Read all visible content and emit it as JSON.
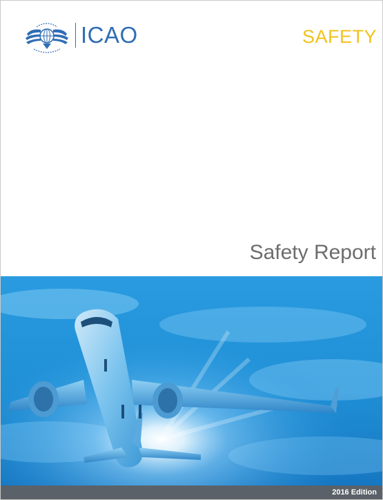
{
  "header": {
    "logo_icon": "un-wreath-emblem-icon",
    "org_name": "ICAO",
    "section_label": "SAFETY"
  },
  "title": "Safety Report",
  "photo": {
    "subject": "airplane-photo"
  },
  "footer": {
    "edition": "2016 Edition"
  },
  "colors": {
    "brand_blue": "#2f6db5",
    "safety_yellow": "#f2c21b",
    "title_gray": "#6d6d6d",
    "footer_bar": "#5a6168",
    "sky_blue": "#1f8fd6"
  }
}
